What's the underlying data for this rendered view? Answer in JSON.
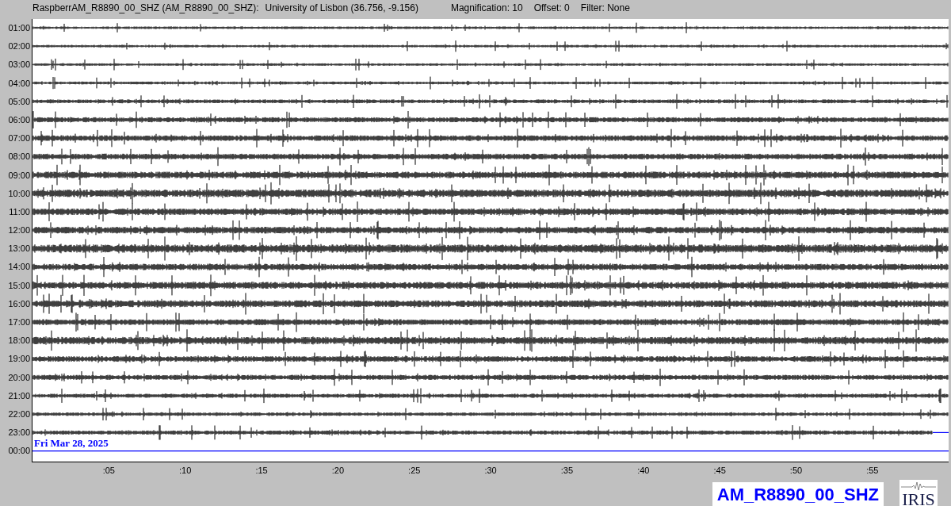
{
  "header": {
    "station": "RaspberrAM_R8890_00_SHZ (AM_R8890_00_SHZ):",
    "location": "University of Lisbon (36.756, -9.156)",
    "magnification": "Magnification: 10",
    "offset": "Offset: 0",
    "filter": "Filter: None"
  },
  "hour_labels": [
    "01:00",
    "02:00",
    "03:00",
    "04:00",
    "05:00",
    "06:00",
    "07:00",
    "08:00",
    "09:00",
    "10:00",
    "11:00",
    "12:00",
    "13:00",
    "14:00",
    "15:00",
    "16:00",
    "17:00",
    "18:00",
    "19:00",
    "20:00",
    "21:00",
    "22:00",
    "23:00",
    "00:00"
  ],
  "date_label": "Fri Mar 28, 2025",
  "minute_ticks": [
    ":05",
    ":10",
    ":15",
    ":20",
    ":25",
    ":30",
    ":35",
    ":40",
    ":45",
    ":50",
    ":55"
  ],
  "channel_label": "AM_R8890_00_SHZ",
  "logo": "IRIS"
}
